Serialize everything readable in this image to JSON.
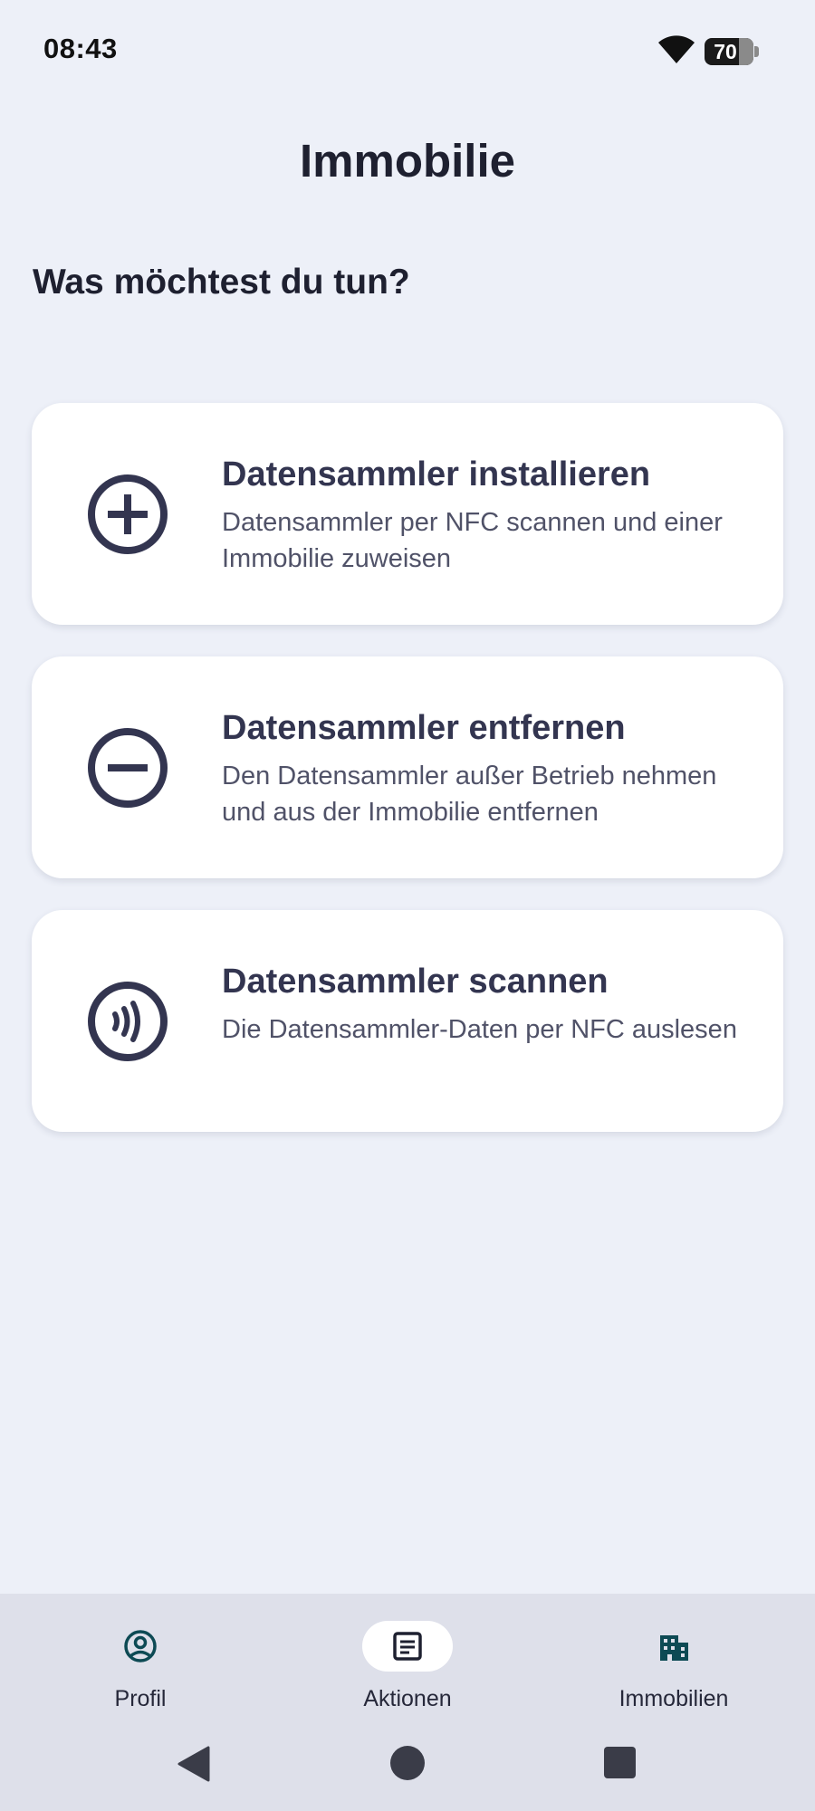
{
  "status_bar": {
    "time": "08:43",
    "battery_percent": "70",
    "wifi_icon": "wifi-icon"
  },
  "header": {
    "title": "Immobilie"
  },
  "prompt": "Was möchtest du tun?",
  "actions": [
    {
      "icon": "add-circle-icon",
      "title": "Datensammler installieren",
      "description": "Datensammler per NFC scannen und einer Immobilie zuweisen"
    },
    {
      "icon": "remove-circle-icon",
      "title": "Datensammler entfernen",
      "description": "Den Datensammler außer Betrieb nehmen und aus der Immobilie entfernen"
    },
    {
      "icon": "contactless-icon",
      "title": "Datensammler scannen",
      "description": "Die Datensammler-Daten per NFC auslesen"
    }
  ],
  "bottom_nav": {
    "items": [
      {
        "label": "Profil",
        "icon": "account-circle-icon",
        "active": false
      },
      {
        "label": "Aktionen",
        "icon": "article-icon",
        "active": true
      },
      {
        "label": "Immobilien",
        "icon": "apartment-icon",
        "active": false
      }
    ]
  },
  "colors": {
    "background": "#edf0f8",
    "card": "#ffffff",
    "icon": "#333550",
    "nav_background": "#dee0ea",
    "nav_icon_teal": "#0d4a54"
  }
}
